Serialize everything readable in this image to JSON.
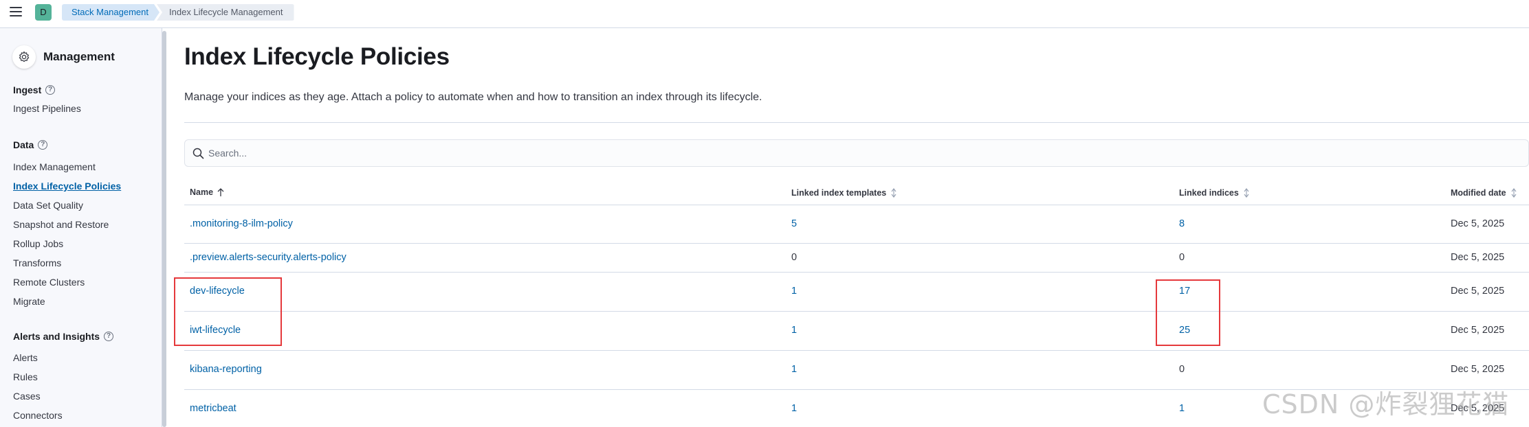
{
  "header": {
    "space_initial": "D",
    "breadcrumbs": [
      "Stack Management",
      "Index Lifecycle Management"
    ]
  },
  "sidebar": {
    "title": "Management",
    "sections": [
      {
        "label": "Ingest",
        "items": [
          "Ingest Pipelines"
        ]
      },
      {
        "label": "Data",
        "items": [
          "Index Management",
          "Index Lifecycle Policies",
          "Data Set Quality",
          "Snapshot and Restore",
          "Rollup Jobs",
          "Transforms",
          "Remote Clusters",
          "Migrate"
        ]
      },
      {
        "label": "Alerts and Insights",
        "items": [
          "Alerts",
          "Rules",
          "Cases",
          "Connectors"
        ]
      }
    ],
    "active_item": "Index Lifecycle Policies"
  },
  "main": {
    "title": "Index Lifecycle Policies",
    "description": "Manage your indices as they age. Attach a policy to automate when and how to transition an index through its lifecycle.",
    "search": {
      "placeholder": "Search...",
      "value": ""
    },
    "table": {
      "columns": [
        "Name",
        "Linked index templates",
        "Linked indices",
        "Modified date"
      ],
      "rows": [
        {
          "name": ".monitoring-8-ilm-policy",
          "templates": "5",
          "indices": "8",
          "modified": "Dec 5, 2025"
        },
        {
          "name": ".preview.alerts-security.alerts-policy",
          "templates": "0",
          "indices": "0",
          "modified": "Dec 5, 2025"
        },
        {
          "name": "dev-lifecycle",
          "templates": "1",
          "indices": "17",
          "modified": "Dec 5, 2025"
        },
        {
          "name": "iwt-lifecycle",
          "templates": "1",
          "indices": "25",
          "modified": "Dec 5, 2025"
        },
        {
          "name": "kibana-reporting",
          "templates": "1",
          "indices": "0",
          "modified": "Dec 5, 2025"
        },
        {
          "name": "metricbeat",
          "templates": "1",
          "indices": "1",
          "modified": "Dec 5, 2025"
        }
      ]
    }
  },
  "watermark": "CSDN @炸裂狸花猫",
  "colors": {
    "link": "#0061a6",
    "highlight": "#e5383b",
    "avatar": "#54b399"
  }
}
